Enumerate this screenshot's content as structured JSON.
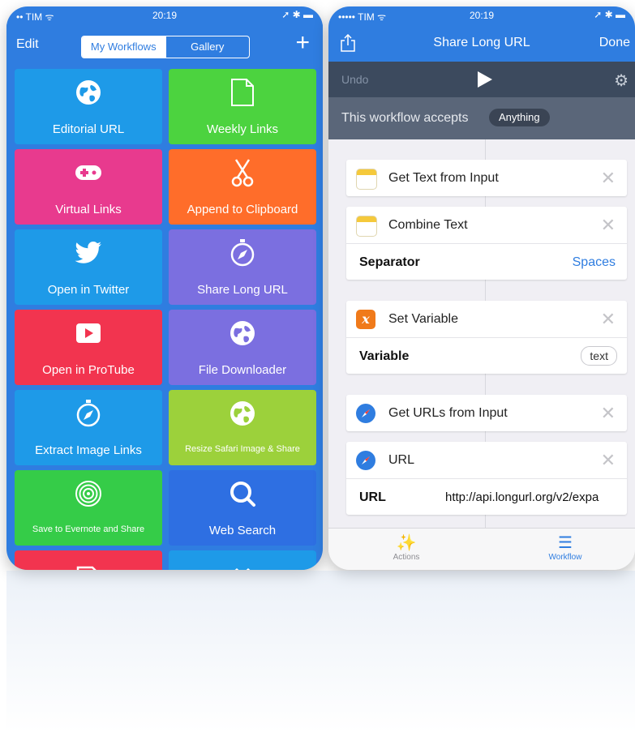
{
  "left_phone": {
    "status": {
      "carrier": "•• TIM ᯤ",
      "time": "20:19",
      "right": "➚ ✱ ▬"
    },
    "nav": {
      "edit_label": "Edit",
      "segments": [
        "My Workflows",
        "Gallery"
      ],
      "add_label": "+"
    },
    "tiles": [
      {
        "label": "Editorial URL",
        "color": "#1e9ae8",
        "icon": "globe-icon"
      },
      {
        "label": "Weekly Links",
        "color": "#4cd33f",
        "icon": "document-icon"
      },
      {
        "label": "Virtual Links",
        "color": "#e83a8e",
        "icon": "gamepad-icon"
      },
      {
        "label": "Append to Clipboard",
        "color": "#ff6d2a",
        "icon": "scissors-icon"
      },
      {
        "label": "Open in Twitter",
        "color": "#1e9ae8",
        "icon": "twitter-bird-icon"
      },
      {
        "label": "Share Long URL",
        "color": "#7b6fe0",
        "icon": "compass-icon"
      },
      {
        "label": "Open in ProTube",
        "color": "#f2344f",
        "icon": "play-box-icon"
      },
      {
        "label": "File Downloader",
        "color": "#7b6fe0",
        "icon": "globe-icon"
      },
      {
        "label": "Extract Image Links",
        "color": "#1e9ae8",
        "icon": "compass-icon"
      },
      {
        "label": "Resize Safari Image & Share",
        "color": "#9cd13b",
        "icon": "globe-icon"
      },
      {
        "label": "Save to Evernote and Share",
        "color": "#35cc48",
        "icon": "target-icon"
      },
      {
        "label": "Web Search",
        "color": "#2e6fe2",
        "icon": "magnifier-icon"
      },
      {
        "label": "",
        "color": "#f2344f",
        "icon": "tag-icon"
      },
      {
        "label": "",
        "color": "#1e9ae8",
        "icon": "shapes-icon"
      }
    ]
  },
  "right_phone": {
    "status": {
      "carrier": "••••• TIM ᯤ",
      "time": "20:19",
      "right": "➚ ✱ ▬"
    },
    "nav": {
      "title": "Share Long URL",
      "done_label": "Done"
    },
    "toolbar": {
      "undo_label": "Undo"
    },
    "accepts": {
      "text": "This workflow accepts",
      "value": "Anything"
    },
    "actions": [
      {
        "title": "Get Text from Input",
        "icon": "notes-icon"
      },
      {
        "title": "Combine Text",
        "icon": "notes-icon",
        "param_name": "Separator",
        "param_value": "Spaces"
      },
      {
        "title": "Set Variable",
        "icon": "variable-icon",
        "icon_glyph": "x",
        "param_name": "Variable",
        "param_value": "text"
      },
      {
        "title": "Get URLs from Input",
        "icon": "safari-icon"
      },
      {
        "title": "URL",
        "icon": "safari-icon",
        "param_name": "URL",
        "param_value": "http://api.longurl.org/v2/expa"
      }
    ],
    "tabs": [
      {
        "label": "Actions",
        "icon": "magic-wand-icon"
      },
      {
        "label": "Workflow",
        "icon": "list-icon"
      }
    ]
  }
}
